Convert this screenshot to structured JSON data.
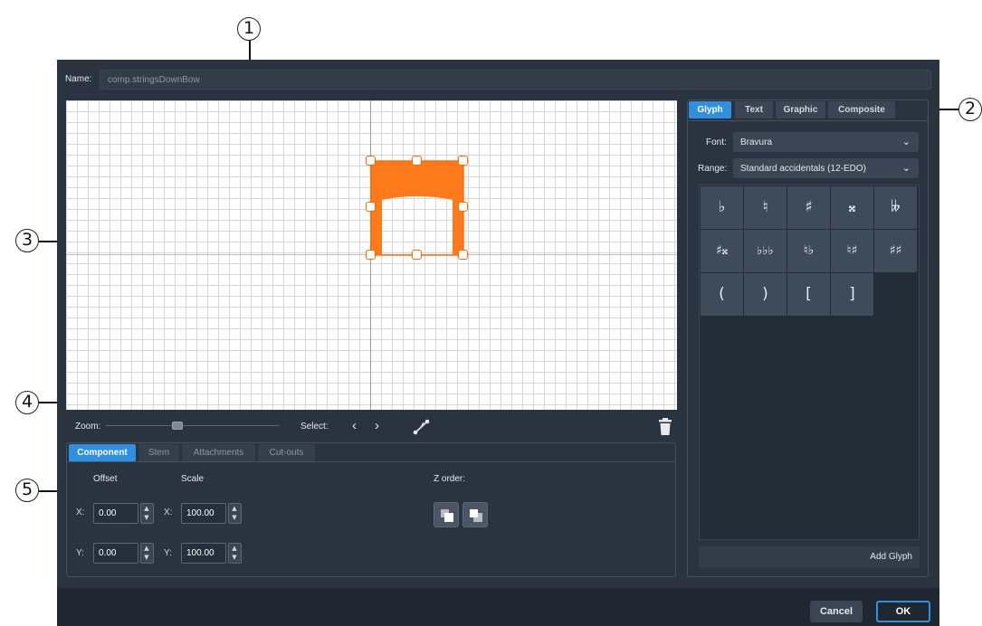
{
  "callouts": [
    "1",
    "2",
    "3",
    "4",
    "5"
  ],
  "name_field": {
    "label": "Name:",
    "value": "comp.stringsDownBow"
  },
  "right_panel": {
    "tabs": [
      "Glyph",
      "Text",
      "Graphic",
      "Composite"
    ],
    "font": {
      "label": "Font:",
      "value": "Bravura"
    },
    "range": {
      "label": "Range:",
      "value": "Standard accidentals (12-EDO)"
    },
    "glyphs": [
      "♭",
      "♮",
      "♯",
      "𝄪",
      "𝄫",
      "♯𝄪",
      "♭♭♭",
      "♮♭",
      "♮♯",
      "♯♯",
      "(",
      ")",
      "[",
      "]"
    ],
    "add_glyph": "Add Glyph"
  },
  "toolbar": {
    "zoom_label": "Zoom:",
    "select_label": "Select:",
    "prev": "‹",
    "next": "›"
  },
  "bottom_tabs": [
    "Component",
    "Stem",
    "Attachments",
    "Cut-outs"
  ],
  "component": {
    "offset_label": "Offset",
    "scale_label": "Scale",
    "z_order_label": "Z order:",
    "x_label": "X:",
    "y_label": "Y:",
    "offset_x": "0.00",
    "offset_y": "0.00",
    "scale_x": "100.00",
    "scale_y": "100.00"
  },
  "buttons": {
    "cancel": "Cancel",
    "ok": "OK"
  },
  "colors": {
    "accent": "#2f8fe0",
    "glyph_fill": "#ff7a1a",
    "handle": "#ff6a00",
    "dialog_bg": "#2a3440"
  }
}
